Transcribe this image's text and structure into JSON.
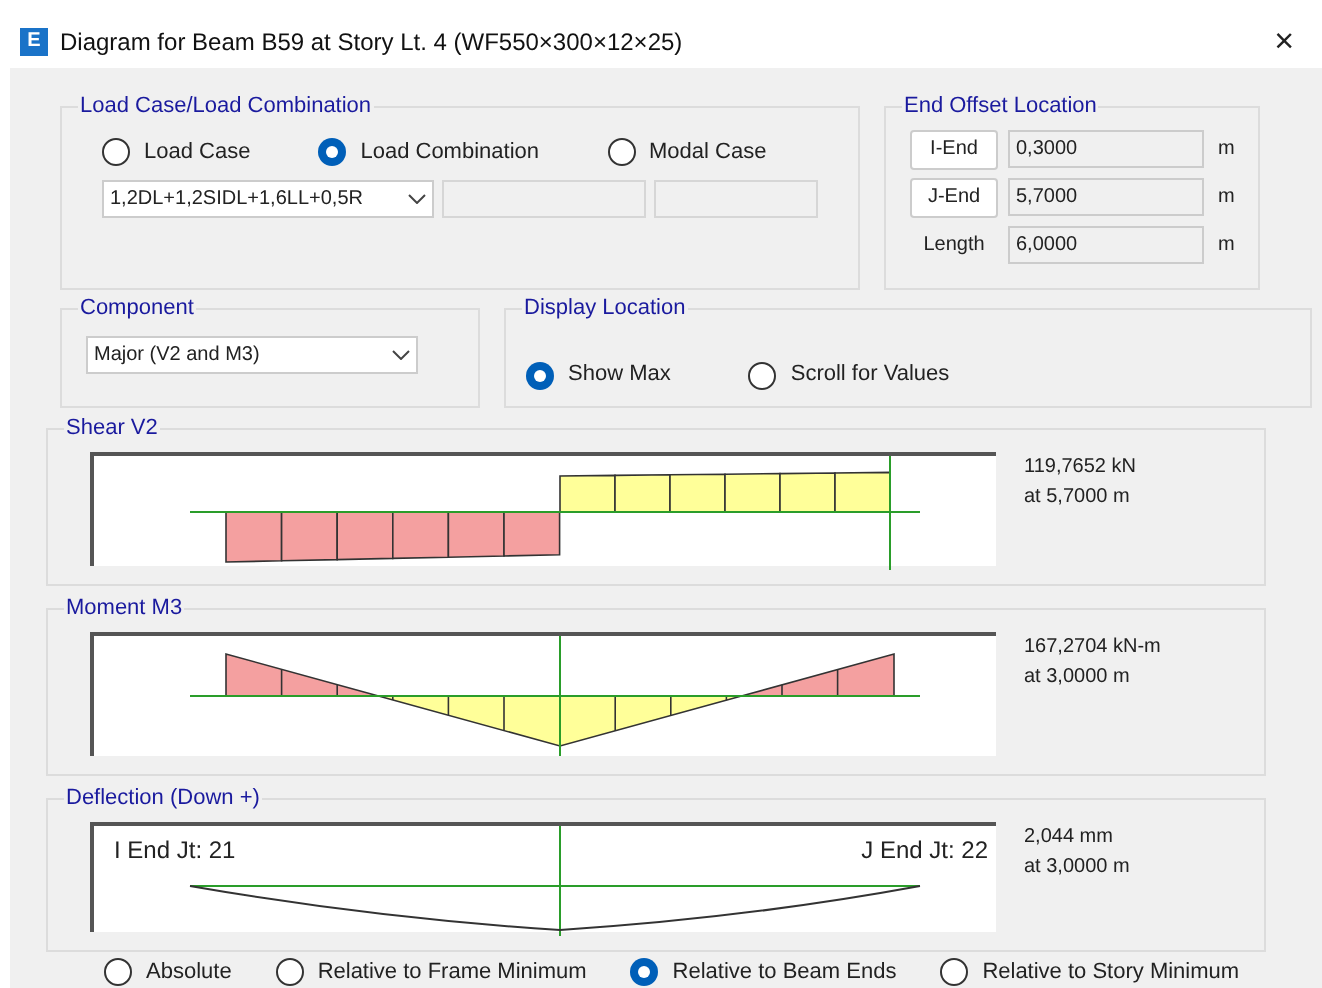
{
  "window": {
    "icon_letter": "E",
    "title": "Diagram for Beam B59 at Story Lt. 4 (WF550×300×12×25)",
    "close": "×"
  },
  "load_case": {
    "title": "Load Case/Load Combination",
    "options": [
      {
        "label": "Load Case",
        "selected": false
      },
      {
        "label": "Load Combination",
        "selected": true
      },
      {
        "label": "Modal Case",
        "selected": false
      }
    ],
    "combo_value": "1,2DL+1,2SIDL+1,6LL+0,5R"
  },
  "end_offset": {
    "title": "End Offset Location",
    "rows": [
      {
        "kind": "button",
        "label": "I-End",
        "value": "0,3000",
        "unit": "m"
      },
      {
        "kind": "button",
        "label": "J-End",
        "value": "5,7000",
        "unit": "m"
      },
      {
        "kind": "label",
        "label": "Length",
        "value": "6,0000",
        "unit": "m"
      }
    ]
  },
  "component": {
    "title": "Component",
    "value": "Major (V2 and M3)"
  },
  "display_location": {
    "title": "Display Location",
    "options": [
      {
        "label": "Show Max",
        "selected": true
      },
      {
        "label": "Scroll for Values",
        "selected": false
      }
    ]
  },
  "diagrams": [
    {
      "kind": "shear",
      "title": "Shear V2",
      "reading": [
        "119,7652 kN",
        "at 5,7000 m"
      ]
    },
    {
      "kind": "moment",
      "title": "Moment M3",
      "reading": [
        "167,2704 kN-m",
        "at 3,0000 m"
      ]
    },
    {
      "kind": "deflection",
      "title": "Deflection (Down +)",
      "reading": [
        "2,044 mm",
        "at 3,0000 m"
      ],
      "i_end": "I End Jt: 21",
      "j_end": "J End Jt: 22"
    }
  ],
  "deflection_options": [
    {
      "label": "Absolute",
      "selected": false
    },
    {
      "label": "Relative to Frame Minimum",
      "selected": false
    },
    {
      "label": "Relative to Beam Ends",
      "selected": true
    },
    {
      "label": "Relative to Story Minimum",
      "selected": false
    }
  ]
}
